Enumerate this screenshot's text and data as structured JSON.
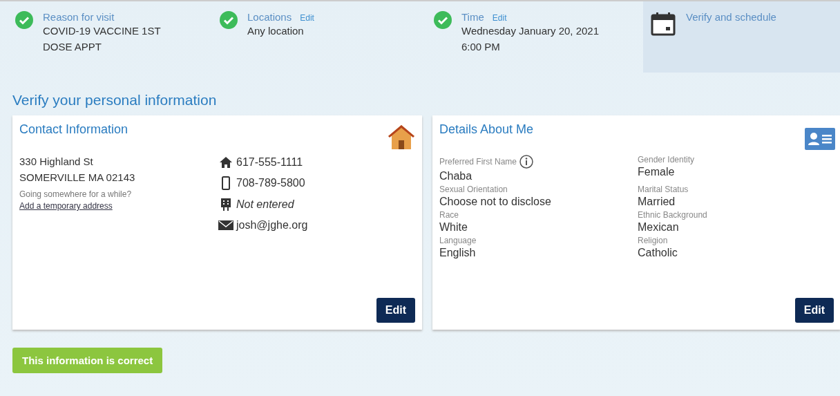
{
  "steps": [
    {
      "label": "Reason for visit",
      "value": [
        "COVID-19 VACCINE 1ST",
        "DOSE APPT"
      ],
      "done": true,
      "selected": false
    },
    {
      "label": "Locations",
      "edit": "Edit",
      "value": [
        "Any location"
      ],
      "done": true,
      "selected": false
    },
    {
      "label": "Time",
      "edit": "Edit",
      "value": [
        "Wednesday January 20, 2021",
        "6:00 PM"
      ],
      "done": true,
      "selected": false
    },
    {
      "label": "Verify and schedule",
      "done": false,
      "selected": true
    }
  ],
  "heading": "Verify your personal information",
  "contact": {
    "title": "Contact Information",
    "address": [
      "330 Highland St",
      "SOMERVILLE MA 02143"
    ],
    "prompt": "Going somewhere for a while?",
    "link": "Add a temporary address",
    "items": [
      {
        "kind": "home",
        "text": "617-555-1111",
        "empty": false
      },
      {
        "kind": "mobile",
        "text": "708-789-5800",
        "empty": false
      },
      {
        "kind": "work",
        "text": "Not entered",
        "empty": true
      },
      {
        "kind": "email",
        "text": "josh@jghe.org",
        "empty": false
      }
    ],
    "button": "Edit"
  },
  "details": {
    "title": "Details About Me",
    "fields": [
      {
        "label": "Preferred First Name",
        "value": "Chaba",
        "info": true
      },
      {
        "label": "Gender Identity",
        "value": "Female",
        "info": false
      },
      {
        "label": "Sexual Orientation",
        "value": "Choose not to disclose",
        "info": false
      },
      {
        "label": "Marital Status",
        "value": "Married",
        "info": false
      },
      {
        "label": "Race",
        "value": "White",
        "info": false
      },
      {
        "label": "Ethnic Background",
        "value": "Mexican",
        "info": false
      },
      {
        "label": "Language",
        "value": "English",
        "info": false
      },
      {
        "label": "Religion",
        "value": "Catholic",
        "info": false
      }
    ],
    "button": "Edit"
  },
  "confirm": "This information is correct"
}
